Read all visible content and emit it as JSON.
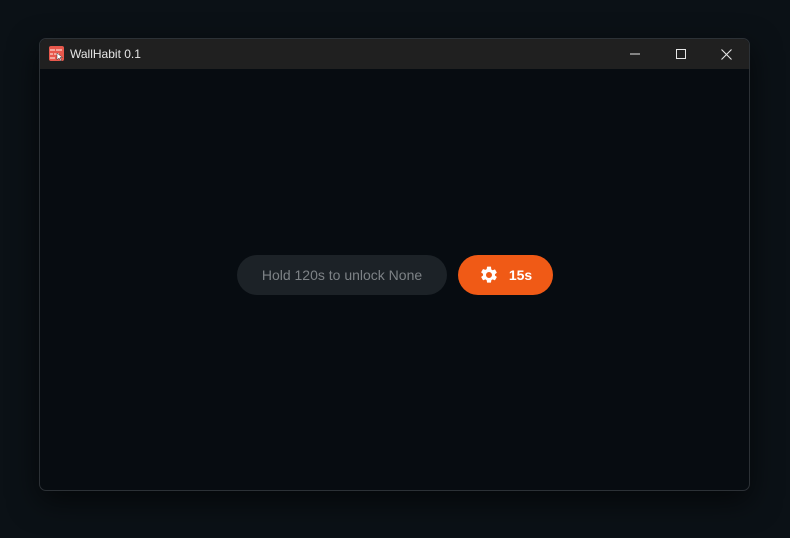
{
  "window": {
    "title": "WallHabit 0.1"
  },
  "main": {
    "hold_text": "Hold 120s to unlock None",
    "timer_label": "15s"
  },
  "icons": {
    "app": "app-icon",
    "minimize": "minimize-icon",
    "maximize": "maximize-icon",
    "close": "close-icon",
    "settings": "gear-icon"
  },
  "colors": {
    "accent": "#f05a16",
    "background": "#070c11",
    "pill": "#1c2227",
    "titlebar": "#202020"
  }
}
